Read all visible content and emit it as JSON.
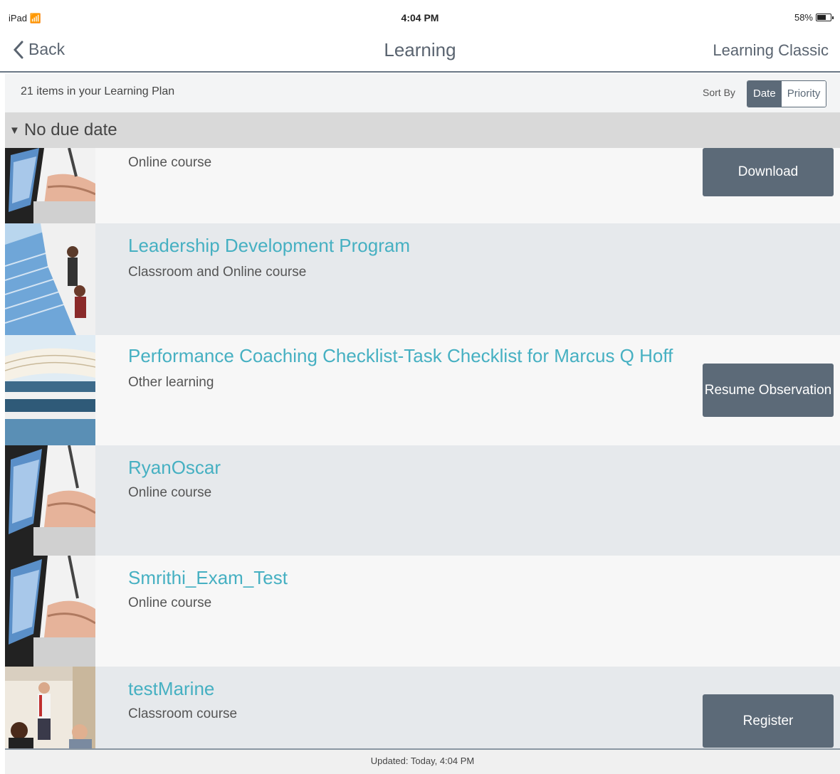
{
  "status_bar": {
    "device": "iPad",
    "time": "4:04 PM",
    "battery": "58%"
  },
  "nav": {
    "back_label": "Back",
    "title": "Learning",
    "right_label": "Learning Classic"
  },
  "plan": {
    "count_label": "21 items in your Learning Plan",
    "sort_label": "Sort By",
    "sort_options": [
      "Date",
      "Priority"
    ],
    "sort_selected": "Date"
  },
  "section": {
    "label": "No due date"
  },
  "items": [
    {
      "title": "",
      "subtitle": "Online course",
      "action": "Download",
      "thumbnail": "computer-typing-image"
    },
    {
      "title": "Leadership Development Program",
      "subtitle": "Classroom and Online course",
      "action": "",
      "thumbnail": "keyboard-presenter-image"
    },
    {
      "title": "Performance Coaching Checklist-Task Checklist for Marcus Q Hoff",
      "subtitle": "Other learning",
      "action": "Resume Observation",
      "thumbnail": "books-image"
    },
    {
      "title": "RyanOscar",
      "subtitle": "Online course",
      "action": "",
      "thumbnail": "computer-typing-image"
    },
    {
      "title": "Smrithi_Exam_Test",
      "subtitle": "Online course",
      "action": "",
      "thumbnail": "computer-typing-image"
    },
    {
      "title": "testMarine",
      "subtitle": "Classroom course",
      "action": "Register",
      "thumbnail": "classroom-presenter-image"
    }
  ],
  "footer": {
    "updated": "Updated: Today, 4:04 PM"
  },
  "colors": {
    "accent": "#46b0c2",
    "button": "#5c6a78",
    "section": "#d9d9d9"
  }
}
